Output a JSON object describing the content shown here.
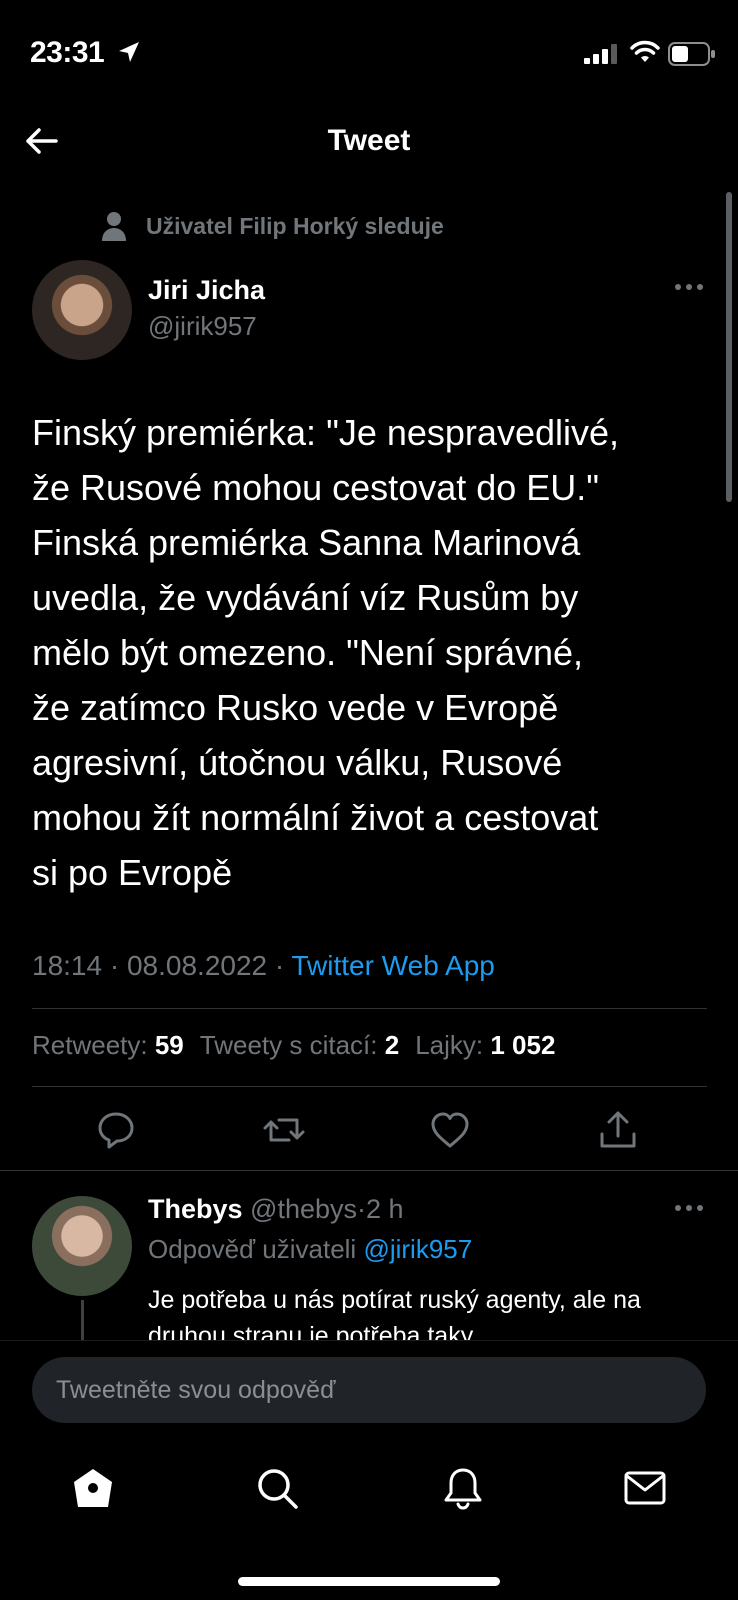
{
  "status_bar": {
    "time": "23:31"
  },
  "header": {
    "title": "Tweet"
  },
  "social_context": {
    "text": "Uživatel Filip Horký sleduje"
  },
  "tweet": {
    "author_name": "Jiri Jicha",
    "author_handle": "@jirik957",
    "text": "Finský premiérka: \"Je nespravedlivé,\nže Rusové mohou cestovat do EU.\"\nFinská premiérka Sanna Marinová\nuvedla, že vydávání víz Rusům by\nmělo být omezeno. \"Není správné,\nže zatímco Rusko vede v Evropě\nagresivní, útočnou válku, Rusové\nmohou žít normální život a cestovat\nsi po Evropě",
    "time": "18:14",
    "separator": "·",
    "date": "08.08.2022",
    "source": "Twitter Web App",
    "stats": {
      "retweets_label": "Retweety:",
      "retweets": "59",
      "quotes_label": "Tweety s citací:",
      "quotes": "2",
      "likes_label": "Lajky:",
      "likes": "1 052"
    }
  },
  "reply": {
    "author_name": "Thebys",
    "author_handle": "@thebys",
    "separator": "·",
    "age": "2 h",
    "replying_to_label": "Odpověď uživateli",
    "replying_to_handle": "@jirik957",
    "text": "Je potřeba u nás potírat ruský agenty, ale na druhou stranu je potřeba taky"
  },
  "composer": {
    "placeholder": "Tweetněte svou odpověď"
  },
  "icons": {
    "back": "arrow-left-icon",
    "reply": "reply-icon",
    "retweet": "retweet-icon",
    "like": "heart-icon",
    "share": "share-icon",
    "home": "home-icon",
    "search": "search-icon",
    "notifications": "bell-icon",
    "messages": "mail-icon"
  },
  "colors": {
    "background": "#000000",
    "accent": "#1d9bf0",
    "secondary_text": "#71767b"
  }
}
